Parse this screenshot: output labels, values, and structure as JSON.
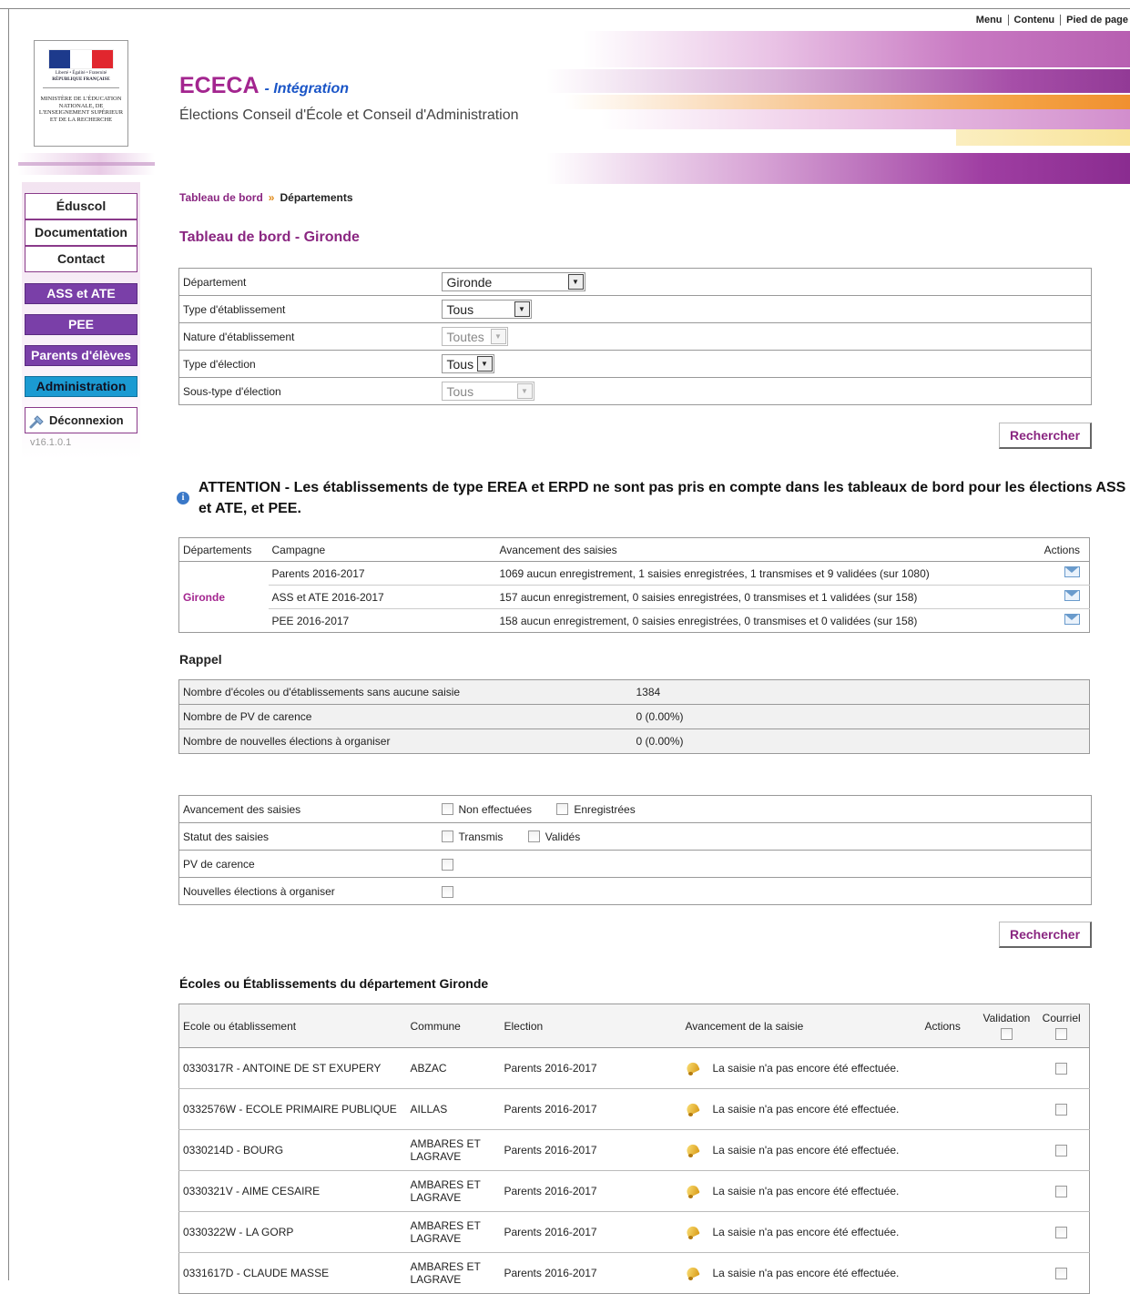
{
  "top_links": {
    "menu": "Menu",
    "contenu": "Contenu",
    "pied_de_page": "Pied de page"
  },
  "header": {
    "title": "ECECA",
    "subtitle_suffix": "- Intégration",
    "tagline": "Élections Conseil d'École et Conseil d'Administration",
    "logo": {
      "caption": "Liberté • Égalité • Fraternité",
      "republic": "République Française",
      "ministry": "Ministère de l'Éducation nationale, de l'Enseignement supérieur et de la Recherche"
    }
  },
  "sidebar": {
    "links": [
      "Éduscol",
      "Documentation",
      "Contact"
    ],
    "campaigns": [
      "ASS et ATE",
      "PEE",
      "Parents d'élèves"
    ],
    "admin": "Administration",
    "logout": "Déconnexion",
    "version": "v16.1.0.1"
  },
  "breadcrumb": {
    "home": "Tableau de bord",
    "current": "Départements"
  },
  "page_title": "Tableau de bord - Gironde",
  "filters": {
    "rows": [
      {
        "label": "Département",
        "value": "Gironde",
        "disabled": false
      },
      {
        "label": "Type d'établissement",
        "value": "Tous",
        "disabled": false
      },
      {
        "label": "Nature d'établissement",
        "value": "Toutes",
        "disabled": true
      },
      {
        "label": "Type d'élection",
        "value": "Tous",
        "disabled": false
      },
      {
        "label": "Sous-type d'élection",
        "value": "Tous",
        "disabled": true
      }
    ],
    "search_label": "Rechercher"
  },
  "warning": "ATTENTION - Les établissements de type EREA et ERPD ne sont pas pris en compte dans les tableaux de bord pour les élections ASS et ATE, et PEE.",
  "campaign_table": {
    "headers": [
      "Départements",
      "Campagne",
      "Avancement des saisies",
      "Actions"
    ],
    "department": "Gironde",
    "rows": [
      {
        "campagne": "Parents 2016-2017",
        "avancement": "1069 aucun enregistrement, 1 saisies enregistrées, 1 transmises et 9 validées (sur 1080)"
      },
      {
        "campagne": "ASS et ATE 2016-2017",
        "avancement": "157 aucun enregistrement, 0 saisies enregistrées, 0 transmises et 1 validées (sur 158)"
      },
      {
        "campagne": "PEE 2016-2017",
        "avancement": "158 aucun enregistrement, 0 saisies enregistrées, 0 transmises et 0 validées (sur 158)"
      }
    ]
  },
  "rappel": {
    "title": "Rappel",
    "rows": [
      {
        "label": "Nombre d'écoles ou d'établissements sans aucune saisie",
        "value": "1384"
      },
      {
        "label": "Nombre de PV de carence",
        "value": "0 (0.00%)"
      },
      {
        "label": "Nombre de nouvelles élections à organiser",
        "value": "0 (0.00%)"
      }
    ]
  },
  "status_filters": {
    "avancement_label": "Avancement des saisies",
    "non_effectuees": "Non effectuées",
    "enregistrees": "Enregistrées",
    "statut_label": "Statut des saisies",
    "transmis": "Transmis",
    "valides": "Validés",
    "pv_label": "PV de carence",
    "nouvelles_label": "Nouvelles élections à organiser",
    "search_label": "Rechercher"
  },
  "establishments": {
    "title": "Écoles ou Établissements du département Gironde",
    "headers": {
      "ecole": "Ecole ou établissement",
      "commune": "Commune",
      "election": "Election",
      "avancement": "Avancement de la saisie",
      "actions": "Actions",
      "validation": "Validation",
      "courriel": "Courriel"
    },
    "rows": [
      {
        "ecole": "0330317R - ANTOINE DE ST EXUPERY",
        "commune": "ABZAC",
        "election": "Parents 2016-2017",
        "status": "La saisie n'a pas encore été effectuée."
      },
      {
        "ecole": "0332576W - ECOLE PRIMAIRE PUBLIQUE",
        "commune": "AILLAS",
        "election": "Parents 2016-2017",
        "status": "La saisie n'a pas encore été effectuée."
      },
      {
        "ecole": "0330214D - BOURG",
        "commune": "AMBARES ET LAGRAVE",
        "election": "Parents 2016-2017",
        "status": "La saisie n'a pas encore été effectuée."
      },
      {
        "ecole": "0330321V - AIME CESAIRE",
        "commune": "AMBARES ET LAGRAVE",
        "election": "Parents 2016-2017",
        "status": "La saisie n'a pas encore été effectuée."
      },
      {
        "ecole": "0330322W - LA GORP",
        "commune": "AMBARES ET LAGRAVE",
        "election": "Parents 2016-2017",
        "status": "La saisie n'a pas encore été effectuée."
      },
      {
        "ecole": "0331617D - CLAUDE MASSE",
        "commune": "AMBARES ET LAGRAVE",
        "election": "Parents 2016-2017",
        "status": "La saisie n'a pas encore été effectuée."
      }
    ]
  },
  "colors": {
    "brand": "#a3258f",
    "accent_blue": "#1a55c7",
    "menu_purple": "#7a3fa8",
    "menu_admin": "#1b9ad2"
  },
  "icons": [
    "info-icon",
    "mail-icon",
    "bell-icon",
    "logout-icon",
    "chevron-down-icon",
    "checkbox"
  ]
}
